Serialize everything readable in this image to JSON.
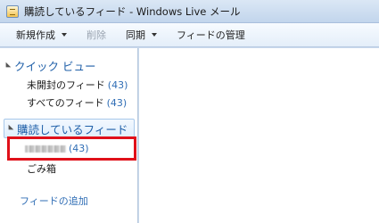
{
  "window": {
    "title": "購読しているフィード - Windows Live メール"
  },
  "toolbar": {
    "new_label": "新規作成",
    "delete_label": "削除",
    "sync_label": "同期",
    "manage_label": "フィードの管理"
  },
  "sidebar": {
    "quick_view": {
      "header": "クイック ビュー",
      "items": [
        {
          "label": "未開封のフィード",
          "count": "(43)"
        },
        {
          "label": "すべてのフィード",
          "count": "(43)"
        }
      ]
    },
    "feeds": {
      "header": "購読しているフィード",
      "items": [
        {
          "label": "",
          "count": "(43)"
        },
        {
          "label": "ごみ箱",
          "count": ""
        }
      ]
    },
    "add_feed_label": "フィードの追加"
  },
  "colors": {
    "accent": "#1f5fa8",
    "count": "#2f6db5",
    "highlight_border": "#e0101a"
  }
}
